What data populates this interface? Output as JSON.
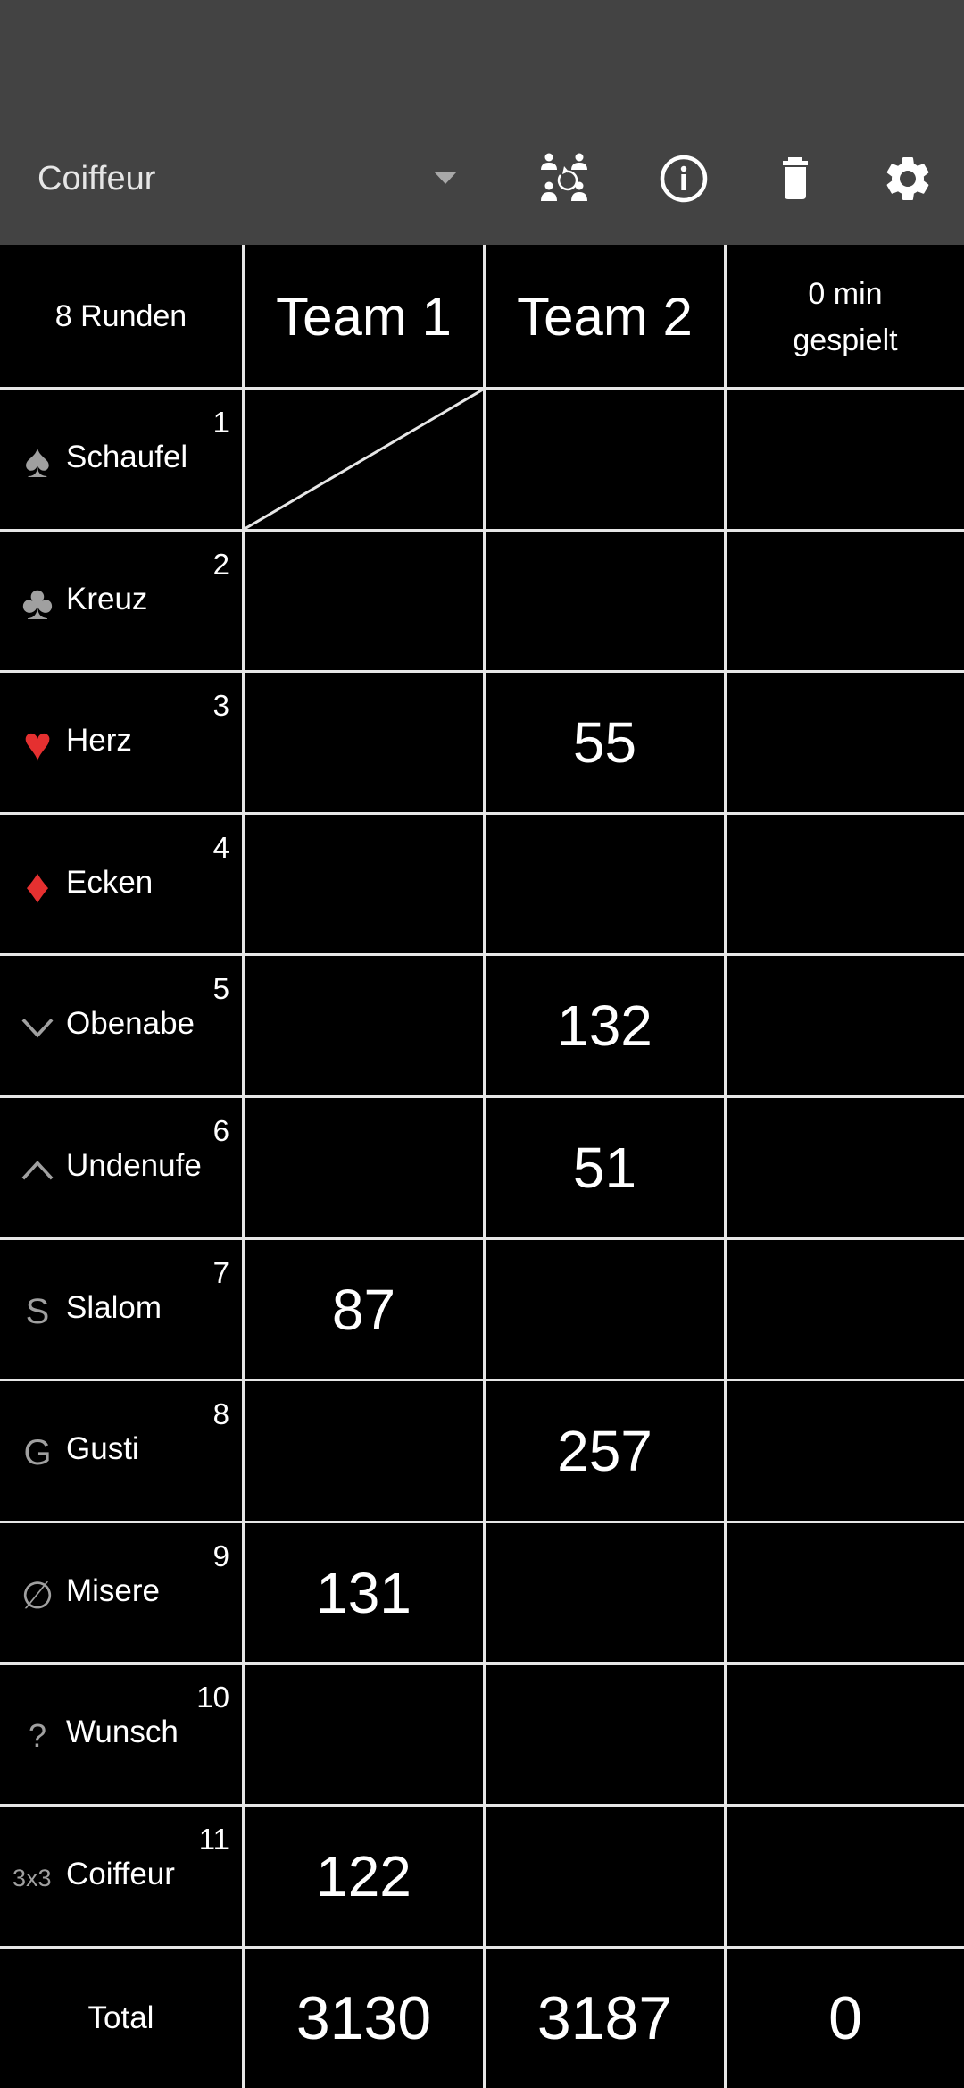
{
  "appbar": {
    "game_select": {
      "value": "Coiffeur"
    },
    "icons": [
      "swap-players-icon",
      "info-icon",
      "delete-icon",
      "settings-icon"
    ]
  },
  "table": {
    "header": {
      "rounds": "8 Runden",
      "team1": "Team 1",
      "team2": "Team 2",
      "time_line1": "0 min",
      "time_line2": "gespielt"
    },
    "rows": [
      {
        "num": "1",
        "icon": "spade-icon",
        "symbol": "♠",
        "symbol_color": "#a0a0a0",
        "name": "Schaufel",
        "team1": "",
        "team2": "",
        "extra": "",
        "team1_crossed": true
      },
      {
        "num": "2",
        "icon": "club-icon",
        "symbol": "♣",
        "symbol_color": "#a0a0a0",
        "name": "Kreuz",
        "team1": "",
        "team2": "",
        "extra": ""
      },
      {
        "num": "3",
        "icon": "heart-icon",
        "symbol": "♥",
        "symbol_color": "#e53030",
        "name": "Herz",
        "team1": "",
        "team2": "55",
        "extra": ""
      },
      {
        "num": "4",
        "icon": "diamond-icon",
        "symbol": "♦",
        "symbol_color": "#e53030",
        "name": "Ecken",
        "team1": "",
        "team2": "",
        "extra": ""
      },
      {
        "num": "5",
        "icon": "chevron-down-icon",
        "symbol": "",
        "symbol_color": "#a0a0a0",
        "name": "Obenabe",
        "team1": "",
        "team2": "132",
        "extra": ""
      },
      {
        "num": "6",
        "icon": "chevron-up-icon",
        "symbol": "",
        "symbol_color": "#a0a0a0",
        "name": "Undenufe",
        "team1": "",
        "team2": "51",
        "extra": ""
      },
      {
        "num": "7",
        "icon": "slalom-s-icon",
        "symbol": "S",
        "symbol_color": "#a0a0a0",
        "name": "Slalom",
        "team1": "87",
        "team2": "",
        "extra": ""
      },
      {
        "num": "8",
        "icon": "gusti-g-icon",
        "symbol": "G",
        "symbol_color": "#a0a0a0",
        "name": "Gusti",
        "team1": "",
        "team2": "257",
        "extra": ""
      },
      {
        "num": "9",
        "icon": "empty-set-icon",
        "symbol": "∅",
        "symbol_color": "#a0a0a0",
        "name": "Misere",
        "team1": "131",
        "team2": "",
        "extra": ""
      },
      {
        "num": "10",
        "icon": "question-icon",
        "symbol": "?",
        "symbol_color": "#a0a0a0",
        "name": "Wunsch",
        "team1": "",
        "team2": "",
        "extra": ""
      },
      {
        "num": "11",
        "icon": "three-by-three-icon",
        "symbol": "3x3",
        "symbol_color": "#a0a0a0",
        "name": "Coiffeur",
        "team1": "122",
        "team2": "",
        "extra": ""
      }
    ],
    "total": {
      "label": "Total",
      "team1": "3130",
      "team2": "3187",
      "extra": "0"
    }
  },
  "colors": {
    "appbar_bg": "#434343",
    "table_bg": "#000000",
    "grid_line": "#e6e6e6",
    "red_suit": "#e53030",
    "gray_symbol": "#a0a0a0"
  }
}
